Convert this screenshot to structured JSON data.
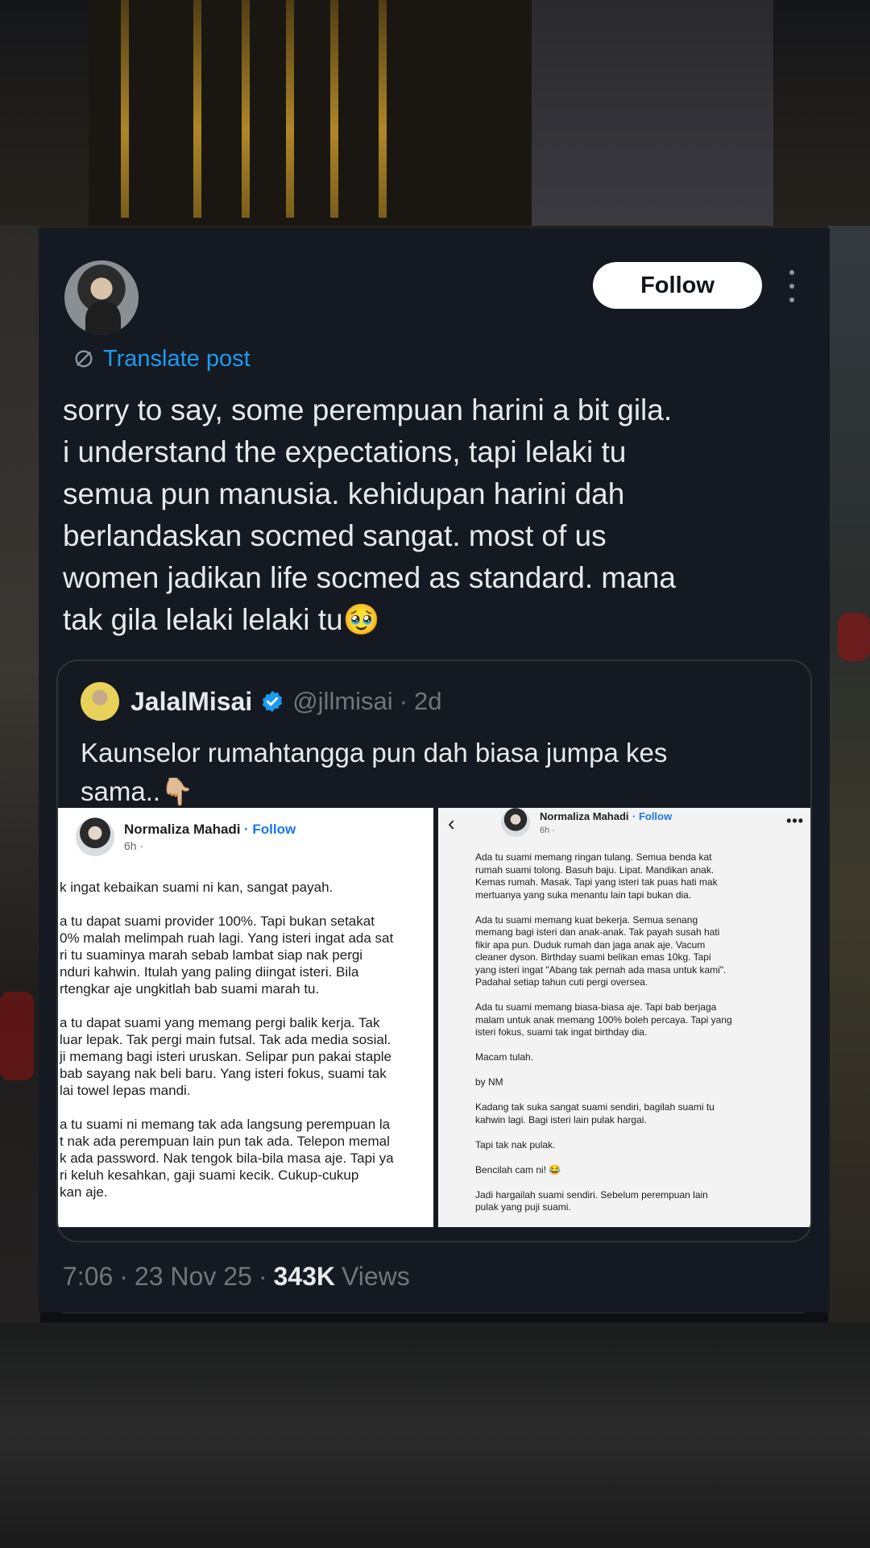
{
  "post": {
    "follow_label": "Follow",
    "translate_label": "Translate post",
    "text": "sorry to say, some perempuan harini a bit gila.\ni understand the expectations, tapi lelaki tu\nsemua pun manusia. kehidupan harini dah\nberlandaskan socmed sangat. most of us\nwomen jadikan life socmed as standard. mana\ntak gila lelaki lelaki tu🥹",
    "time": "7:06",
    "date": "23 Nov 25",
    "views_count": "343K",
    "views_label": "Views",
    "separator": "·"
  },
  "quote": {
    "name": "JalalMisai",
    "handle": "@jllmisai",
    "age": "2d",
    "text": "Kaunselor rumahtangga pun dah biasa jumpa kes\nsama..👇🏼",
    "images": [
      {
        "author": "Normaliza Mahadi",
        "follow": "Follow",
        "time": "6h ·",
        "body": "k ingat kebaikan suami ni kan, sangat payah.\n\na tu dapat suami provider 100%. Tapi bukan setakat\n0% malah melimpah ruah lagi. Yang isteri ingat ada sat\nri tu suaminya marah sebab lambat siap nak pergi\nnduri kahwin. Itulah yang paling diingat isteri. Bila\nrtengkar aje ungkitlah bab suami marah tu.\n\na tu dapat suami yang memang pergi balik kerja. Tak\nluar lepak. Tak pergi main futsal. Tak ada media sosial.\nji memang bagi isteri uruskan. Selipar pun pakai staple\nbab sayang nak beli baru. Yang isteri fokus, suami tak\nlai towel lepas mandi.\n\na tu suami ni memang tak ada langsung perempuan la\nt nak ada perempuan lain pun tak ada. Telepon memal\nk ada password. Nak tengok bila-bila masa aje. Tapi ya\nri keluh kesahkan, gaji suami kecik. Cukup-cukup\nkan aje."
      },
      {
        "author": "Normaliza Mahadi",
        "follow": "Follow",
        "time": "6h ·",
        "back": "‹",
        "dots": "•••",
        "body": "Ada tu suami memang ringan tulang. Semua benda kat\nrumah suami tolong. Basuh baju. Lipat. Mandikan anak.\nKemas rumah. Masak. Tapi yang isteri tak puas hati mak\nmertuanya yang suka menantu lain tapi bukan dia.\n\nAda tu suami memang kuat bekerja. Semua senang\nmemang bagi isteri dan anak-anak. Tak payah susah hati\nfikir apa pun. Duduk rumah dan jaga anak aje. Vacum\ncleaner dyson. Birthday suami belikan emas 10kg. Tapi\nyang isteri ingat \"Abang tak pernah ada masa untuk kami\".\nPadahal setiap tahun cuti pergi oversea.\n\nAda tu suami memang biasa-biasa aje. Tapi bab berjaga\nmalam untuk anak memang 100% boleh percaya. Tapi yang\nisteri fokus, suami tak ingat birthday dia.\n\nMacam tulah.\n\nby NM\n\nKadang tak suka sangat suami sendiri, bagilah suami tu\nkahwin lagi. Bagi isteri lain pulak hargai.\n\nTapi tak nak pulak.\n\nBencilah cam ni! 😂\n\nJadi hargailah suami sendiri. Sebelum perempuan lain\npulak yang puji suami."
      }
    ]
  },
  "icons": {
    "more": "more-vertical-icon",
    "translate": "translate-icon",
    "verified": "verified-badge-icon"
  },
  "colors": {
    "card_bg": "#151a22",
    "link_blue": "#1d9bf0",
    "text_primary": "#e7e9ea",
    "text_secondary": "#71767b",
    "verified_blue": "#1d9bf0",
    "fb_blue": "#1877f2"
  }
}
